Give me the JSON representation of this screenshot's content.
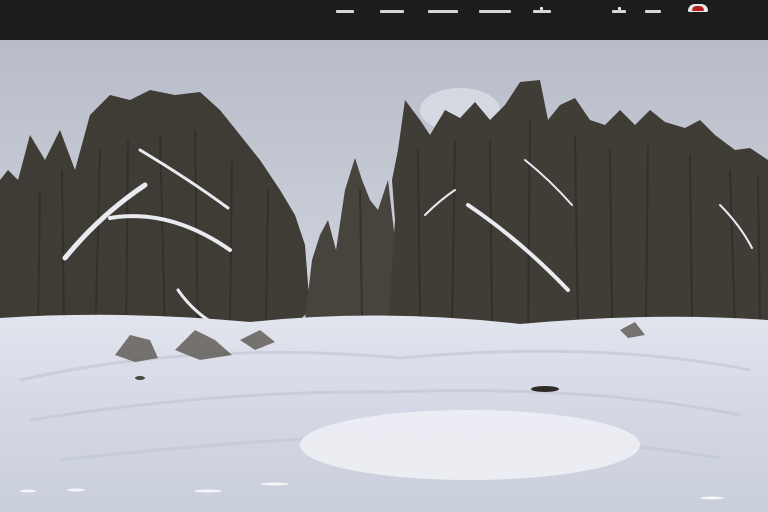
{
  "scene": {
    "description_colors": {
      "sky": "#c8ccd6",
      "forest": "#3e3a34",
      "snow": "#e4e7ef",
      "topbar": "#1c1c1f",
      "indicator": "#b22222"
    }
  }
}
